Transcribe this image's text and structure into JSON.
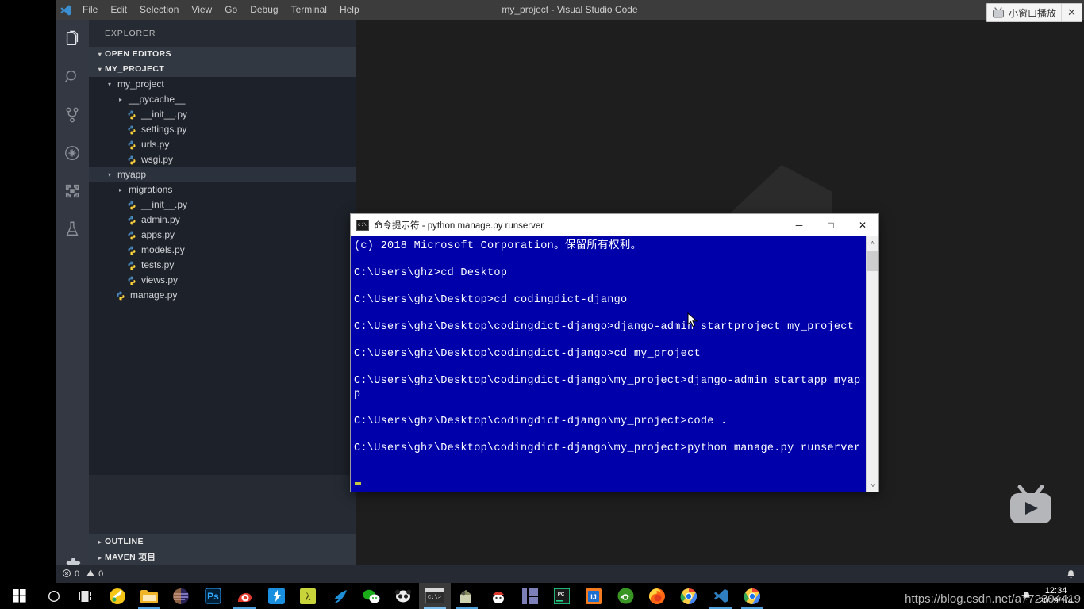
{
  "vscode": {
    "window_title": "my_project - Visual Studio Code",
    "logo_icon": "vscode-logo-icon",
    "menus": [
      {
        "label": "File"
      },
      {
        "label": "Edit"
      },
      {
        "label": "Selection"
      },
      {
        "label": "View"
      },
      {
        "label": "Go"
      },
      {
        "label": "Debug"
      },
      {
        "label": "Terminal"
      },
      {
        "label": "Help"
      }
    ],
    "window_controls": [
      {
        "name": "minimize-button",
        "glyph": "─"
      },
      {
        "name": "maximize-button",
        "glyph": "□"
      },
      {
        "name": "close-button",
        "glyph": "✕"
      }
    ],
    "activity_bar": [
      {
        "name": "explorer-icon",
        "label": "Explorer",
        "active": true
      },
      {
        "name": "search-icon",
        "label": "Search",
        "active": false
      },
      {
        "name": "source-control-icon",
        "label": "Source Control",
        "active": false
      },
      {
        "name": "debug-icon",
        "label": "Debug",
        "active": false
      },
      {
        "name": "extensions-icon",
        "label": "Extensions",
        "active": false
      },
      {
        "name": "test-beaker-icon",
        "label": "Test",
        "active": false
      },
      {
        "name": "settings-gear-icon",
        "label": "Settings",
        "active": false
      }
    ],
    "explorer": {
      "title": "EXPLORER",
      "open_editors": {
        "label": "OPEN EDITORS",
        "twisty": "▾"
      },
      "project_root": {
        "label": "MY_PROJECT",
        "twisty": "▾"
      },
      "tree": [
        {
          "label": "my_project",
          "indent": 1,
          "type": "folder",
          "twisty": "▾",
          "selected": false
        },
        {
          "label": "__pycache__",
          "indent": 2,
          "type": "folder",
          "twisty": "▸",
          "selected": false
        },
        {
          "label": "__init__.py",
          "indent": 2,
          "type": "python",
          "selected": false
        },
        {
          "label": "settings.py",
          "indent": 2,
          "type": "python",
          "selected": false
        },
        {
          "label": "urls.py",
          "indent": 2,
          "type": "python",
          "selected": false
        },
        {
          "label": "wsgi.py",
          "indent": 2,
          "type": "python",
          "selected": false
        },
        {
          "label": "myapp",
          "indent": 1,
          "type": "folder",
          "twisty": "▾",
          "selected": true
        },
        {
          "label": "migrations",
          "indent": 2,
          "type": "folder",
          "twisty": "▸",
          "selected": false
        },
        {
          "label": "__init__.py",
          "indent": 2,
          "type": "python",
          "selected": false
        },
        {
          "label": "admin.py",
          "indent": 2,
          "type": "python",
          "selected": false
        },
        {
          "label": "apps.py",
          "indent": 2,
          "type": "python",
          "selected": false
        },
        {
          "label": "models.py",
          "indent": 2,
          "type": "python",
          "selected": false
        },
        {
          "label": "tests.py",
          "indent": 2,
          "type": "python",
          "selected": false
        },
        {
          "label": "views.py",
          "indent": 2,
          "type": "python",
          "selected": false
        },
        {
          "label": "manage.py",
          "indent": 1,
          "type": "python",
          "selected": false
        }
      ],
      "bottom_sections": [
        {
          "label": "OUTLINE",
          "twisty": "▸"
        },
        {
          "label": "MAVEN 项目",
          "twisty": "▸"
        }
      ]
    },
    "status_bar": {
      "errors_icon": "error-circle-icon",
      "errors": "0",
      "warnings_icon": "warning-triangle-icon",
      "warnings": "0",
      "bell_icon": "bell-icon"
    }
  },
  "cmd_window": {
    "icon": "command-prompt-icon",
    "title": "命令提示符 - python  manage.py runserver",
    "controls": [
      {
        "name": "cmd-minimize-button",
        "glyph": "─"
      },
      {
        "name": "cmd-maximize-button",
        "glyph": "□"
      },
      {
        "name": "cmd-close-button",
        "glyph": "✕"
      }
    ],
    "background_color": "#0000aa",
    "text": "(c) 2018 Microsoft Corporation。保留所有权利。\n\nC:\\Users\\ghz>cd Desktop\n\nC:\\Users\\ghz\\Desktop>cd codingdict-django\n\nC:\\Users\\ghz\\Desktop\\codingdict-django>django-admin startproject my_project\n\nC:\\Users\\ghz\\Desktop\\codingdict-django>cd my_project\n\nC:\\Users\\ghz\\Desktop\\codingdict-django\\my_project>django-admin startapp myapp\n\nC:\\Users\\ghz\\Desktop\\codingdict-django\\my_project>code .\n\nC:\\Users\\ghz\\Desktop\\codingdict-django\\my_project>python manage.py runserver\n",
    "scrollbar": {
      "up_glyph": "˄",
      "down_glyph": "˅"
    }
  },
  "float_play": {
    "icon": "tv-icon",
    "label": "小窗口播放",
    "close_glyph": "✕"
  },
  "bili_logo": {
    "name": "bilibili-play-logo-icon"
  },
  "taskbar": {
    "items": [
      {
        "name": "start-button-icon",
        "running": false,
        "active": false
      },
      {
        "name": "cortana-search-icon",
        "running": false,
        "active": false
      },
      {
        "name": "task-view-icon",
        "running": false,
        "active": false
      },
      {
        "name": "sogou-input-icon",
        "running": false,
        "active": false
      },
      {
        "name": "file-explorer-icon",
        "running": true,
        "active": false
      },
      {
        "name": "navicat-icon",
        "running": false,
        "active": false
      },
      {
        "name": "photoshop-icon",
        "running": false,
        "active": false
      },
      {
        "name": "thunder-snail-icon",
        "running": true,
        "active": false
      },
      {
        "name": "xunlei-icon",
        "running": false,
        "active": false
      },
      {
        "name": "lambda-editor-icon",
        "running": false,
        "active": false
      },
      {
        "name": "swallow-browser-icon",
        "running": false,
        "active": false
      },
      {
        "name": "wechat-icon",
        "running": false,
        "active": false
      },
      {
        "name": "panda-tool-icon",
        "running": false,
        "active": false
      },
      {
        "name": "command-prompt-taskbar-icon",
        "running": true,
        "active": true
      },
      {
        "name": "postman-icon",
        "running": true,
        "active": false
      },
      {
        "name": "tomcat-icon",
        "running": false,
        "active": false
      },
      {
        "name": "navicat-premium-icon",
        "running": false,
        "active": false
      },
      {
        "name": "pycharm-icon",
        "running": false,
        "active": false
      },
      {
        "name": "intellij-idea-icon",
        "running": false,
        "active": false
      },
      {
        "name": "anaconda-icon",
        "running": false,
        "active": false
      },
      {
        "name": "firefox-icon",
        "running": false,
        "active": false
      },
      {
        "name": "chrome-icon",
        "running": false,
        "active": false
      },
      {
        "name": "vscode-taskbar-icon",
        "running": true,
        "active": false
      },
      {
        "name": "chrome-second-icon",
        "running": true,
        "active": false
      }
    ],
    "tray": {
      "bell_icon": "notification-bell-icon",
      "time": "12:34",
      "date": "2019/1/4"
    }
  },
  "watermark": "https://blog.csdn.net/a772304419",
  "colors": {
    "vscode_titlebar": "#3c3c3c",
    "activity_bar": "#333842",
    "sidebar": "#252a33",
    "tree_bg": "#1d2129",
    "editor_bg": "#1e1e1e",
    "status_bar": "#262b33",
    "cmd_blue": "#0000aa",
    "taskbar": "#000000",
    "accent_blue": "#50a0dc"
  }
}
